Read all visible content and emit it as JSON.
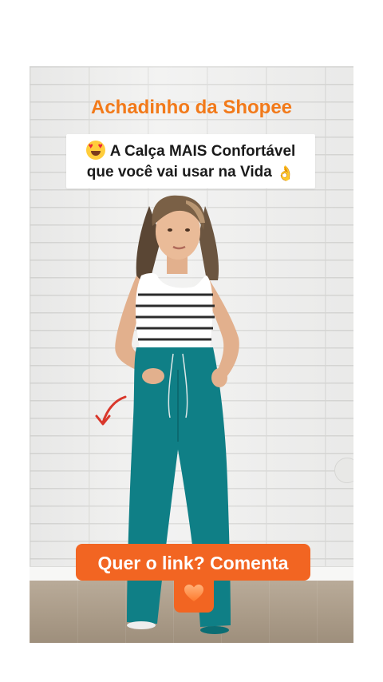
{
  "video": {
    "title": "Achadinho da Shopee",
    "headline_line1": "A Calça MAIS Confortável",
    "headline_line2": "que você vai usar na Vida",
    "emoji_start": "heart-eyes-emoji",
    "emoji_end": "ok-hand-emoji",
    "cta": "Quer o link? Comenta",
    "cta_icon": "orange-heart-icon",
    "colors": {
      "title_orange": "#f27a1a",
      "cta_orange": "#f26522",
      "pants_teal": "#0f7f86",
      "arrow_red": "#d9372b"
    }
  }
}
